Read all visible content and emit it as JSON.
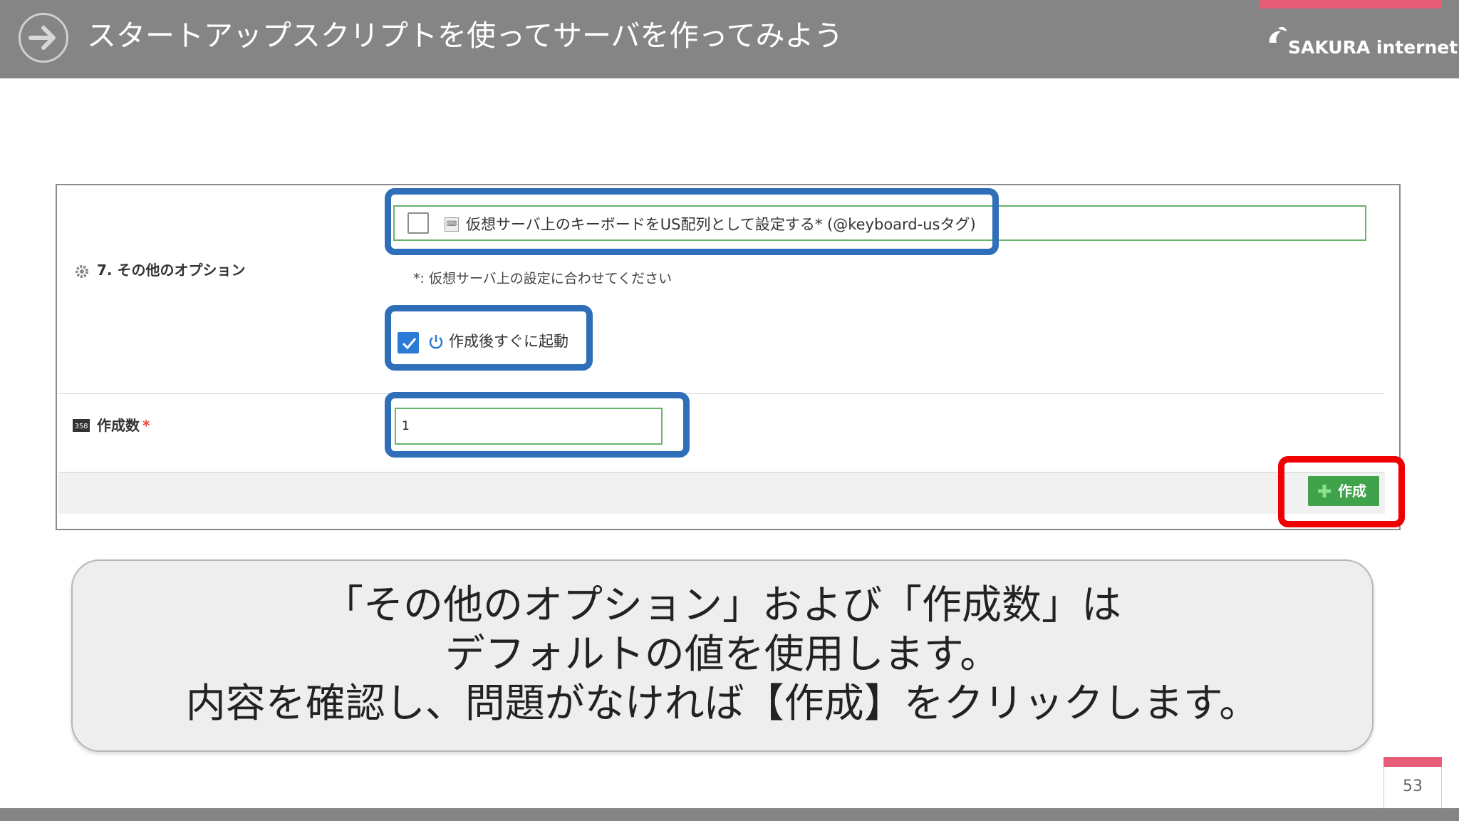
{
  "slide": {
    "title": "スタートアップスクリプトを使ってサーバを作ってみよう",
    "brand": "SAKURA internet",
    "page_number": "53",
    "colors": {
      "header": "#858585",
      "brand_accent": "#e75d78",
      "highlight_blue": "#2f6eb8",
      "highlight_red": "#f00000",
      "create_button": "#3ea34a",
      "field_border": "#6ab46a"
    }
  },
  "form": {
    "options_section": {
      "icon": "gear-icon",
      "label": "7. その他のオプション",
      "keyboard_checkbox": {
        "checked": false,
        "label": "仮想サーバ上のキーボードをUS配列として設定する* (@keyboard-usタグ)"
      },
      "note": "*: 仮想サーバ上の設定に合わせてください",
      "boot_checkbox": {
        "checked": true,
        "icon": "power-icon",
        "label": "作成後すぐに起動"
      }
    },
    "count_section": {
      "icon": "count-icon",
      "label": "作成数",
      "required": "*",
      "value": "1"
    },
    "create_button": {
      "icon": "plus-icon",
      "label": "作成"
    }
  },
  "caption": {
    "line1": "「その他のオプション」および「作成数」は",
    "line2": "デフォルトの値を使用します。",
    "line3": "内容を確認し、問題がなければ【作成】をクリックします。"
  }
}
